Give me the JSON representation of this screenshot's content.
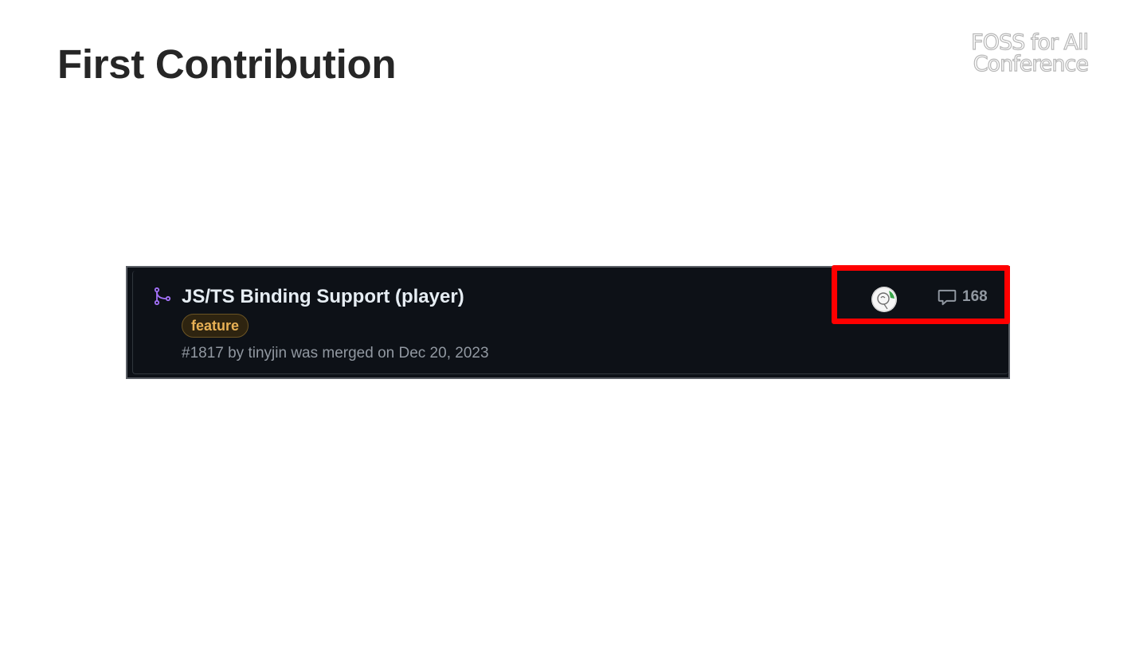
{
  "slide": {
    "title": "First Contribution",
    "logo": {
      "line1": "FOSS for All",
      "line2": "Conference"
    }
  },
  "pull_request": {
    "status_icon": "git-merge-icon",
    "title": "JS/TS Binding Support (player)",
    "label": "feature",
    "meta": "#1817 by tinyjin was merged on Dec 20, 2023",
    "avatar_icon": "user-avatar",
    "comment_icon": "comment-icon",
    "comment_count": "168"
  },
  "annotation": {
    "highlight": "avatar-and-comment-count"
  },
  "colors": {
    "background": "#ffffff",
    "title": "#262626",
    "panel": "#0d1117",
    "pr_title": "#e6edf3",
    "merged_purple": "#a371f7",
    "label_text": "#e8b155",
    "muted": "#9198a1",
    "highlight": "#ff0000"
  }
}
